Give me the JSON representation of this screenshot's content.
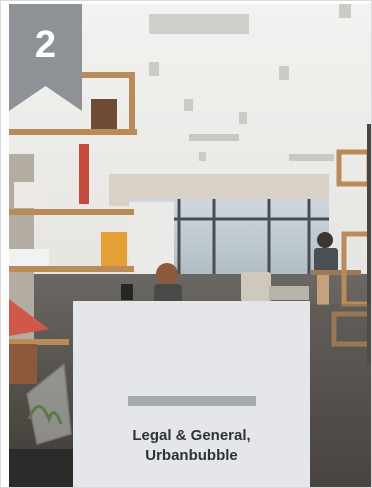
{
  "badge": {
    "rank": "2",
    "color": "#8e9297"
  },
  "caption": {
    "title_line1": "Legal & General,",
    "title_line2": "Urbanbubble",
    "panel_color": "#e4e6ea",
    "bar_color": "#a7aaae",
    "text_color": "#2f3236"
  },
  "photo": {
    "icon": "office-interior-photo"
  }
}
